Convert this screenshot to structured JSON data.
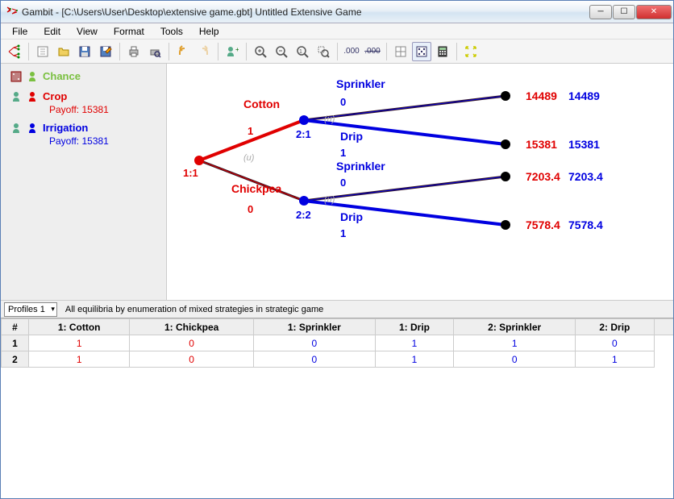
{
  "title": "Gambit - [C:\\Users\\User\\Desktop\\extensive game.gbt] Untitled Extensive Game",
  "menu": {
    "file": "File",
    "edit": "Edit",
    "view": "View",
    "format": "Format",
    "tools": "Tools",
    "help": "Help"
  },
  "players": {
    "chance": {
      "label": "Chance",
      "color": "#7ac040"
    },
    "p1": {
      "label": "Crop",
      "payoff_label": "Payoff: 15381",
      "color": "#e00000"
    },
    "p2": {
      "label": "Irrigation",
      "payoff_label": "Payoff: 15381",
      "color": "#0000e0"
    }
  },
  "tree": {
    "root": {
      "label": "1:1"
    },
    "branches": {
      "b1": {
        "label": "Cotton",
        "prob": "1"
      },
      "b2": {
        "label": "Chickpea",
        "prob": "0"
      }
    },
    "infosets": {
      "n1": "2:1",
      "n2": "2:2"
    },
    "actions": {
      "a1": {
        "label": "Sprinkler",
        "prob": "0"
      },
      "a2": {
        "label": "Drip",
        "prob": "1"
      },
      "a3": {
        "label": "Sprinkler",
        "prob": "0"
      },
      "a4": {
        "label": "Drip",
        "prob": "1"
      }
    },
    "payoffs": {
      "t1": {
        "p1": "14489",
        "p2": "14489"
      },
      "t2": {
        "p1": "15381",
        "p2": "15381"
      },
      "t3": {
        "p1": "7203.4",
        "p2": "7203.4"
      },
      "t4": {
        "p1": "7578.4",
        "p2": "7578.4"
      }
    },
    "u_label": "(u)"
  },
  "profiles": {
    "selector": "Profiles 1",
    "desc": "All equilibria by enumeration of mixed strategies in strategic game"
  },
  "table": {
    "headers": {
      "h0": "#",
      "h1": "1: Cotton",
      "h2": "1: Chickpea",
      "h3": "1: Sprinkler",
      "h4": "1: Drip",
      "h5": "2: Sprinkler",
      "h6": "2: Drip"
    },
    "rows": [
      {
        "n": "1",
        "c1": "1",
        "c2": "0",
        "c3": "0",
        "c4": "1",
        "c5": "1",
        "c6": "0"
      },
      {
        "n": "2",
        "c1": "1",
        "c2": "0",
        "c3": "0",
        "c4": "1",
        "c5": "0",
        "c6": "1"
      }
    ],
    "colors": {
      "p1": "#e00000",
      "p2": "#0000e0"
    }
  }
}
